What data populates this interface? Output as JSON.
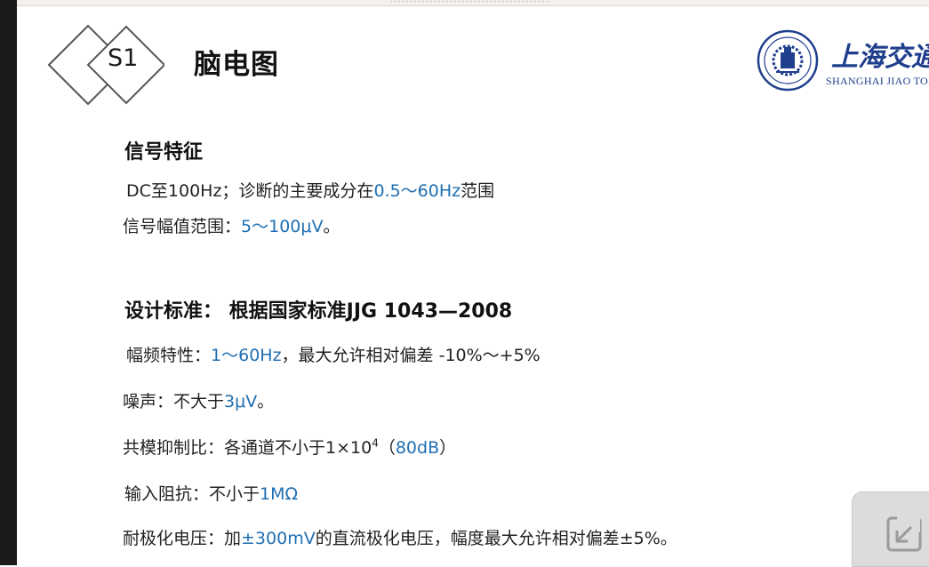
{
  "top_strip": {
    "text": "……………………………………………………"
  },
  "section": {
    "number": "S1",
    "title": "脑电图"
  },
  "logo": {
    "name_cn": "上海交通",
    "name_en": "SHANGHAI JIAO TONG",
    "seal_text": "SHANGHAI JIAO TONG UNIVERSITY",
    "color": "#1f3f8c"
  },
  "signal": {
    "heading": "信号特征",
    "line1": {
      "pre": "DC至100Hz；诊断的主要成分在",
      "hl": "0.5～60Hz",
      "post": "范围"
    },
    "line2": {
      "pre": "信号幅值范围：",
      "hl": "5～100μV",
      "post": "。"
    }
  },
  "standard": {
    "heading": "设计标准： 根据国家标准JJG 1043—2008",
    "line1": {
      "pre": "幅频特性：",
      "hl": "1～60Hz",
      "post": "，最大允许相对偏差 -10%～+5%"
    },
    "line2": {
      "pre": "噪声：不大于",
      "hl": "3μV",
      "post": "。"
    },
    "line3": {
      "pre": "共模抑制比：各通道不小于1×10",
      "sup": "4",
      "mid": "（",
      "hl": "80dB",
      "post": "）"
    },
    "line4": {
      "pre": "输入阻抗：不小于",
      "hl": "1MΩ",
      "post": ""
    },
    "line5": {
      "pre": "耐极化电压：加",
      "hl": "±300mV",
      "post": "的直流极化电压，幅度最大允许相对偏差±5%。"
    }
  },
  "colors": {
    "highlight": "#1f6fb2",
    "text": "#222222"
  },
  "widget": {
    "icon": "expand-icon"
  }
}
